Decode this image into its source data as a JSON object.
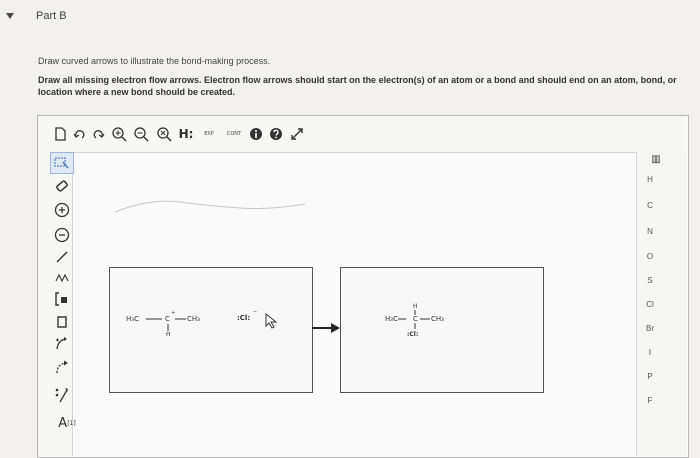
{
  "part": {
    "title": "Part B"
  },
  "prompt": {
    "line1": "Draw curved arrows to illustrate the bond-making process.",
    "line2": "Draw all missing electron flow arrows. Electron flow arrows should start on the electron(s) of an atom or a bond and should end on an atom, bond, or location where a new bond should be created."
  },
  "toolbar": {
    "h_dots_label": "H:",
    "exp_label": "EXP",
    "cont_label": "CONT"
  },
  "left_toolbar": {
    "abbrev_label": "A",
    "abbrev_superscript": "[1]"
  },
  "elements": [
    "H",
    "C",
    "N",
    "O",
    "S",
    "Cl",
    "Br",
    "I",
    "P",
    "F"
  ],
  "periodic_label": "▥",
  "reactants": {
    "left_group": "H₃C",
    "center_atom": "C",
    "center_charge": "+",
    "center_h": "H",
    "right_group": "CH₃",
    "nucleophile": ":Cl:",
    "nucleophile_charge": "−"
  },
  "product": {
    "left_group": "H₃C",
    "center_atom": "C",
    "center_h": "H",
    "right_group": "CH₃",
    "substituent": ":Cl:"
  },
  "colors": {
    "accent": "#3a6fb0",
    "background": "#f2f1ef",
    "panel": "#fafafa"
  }
}
